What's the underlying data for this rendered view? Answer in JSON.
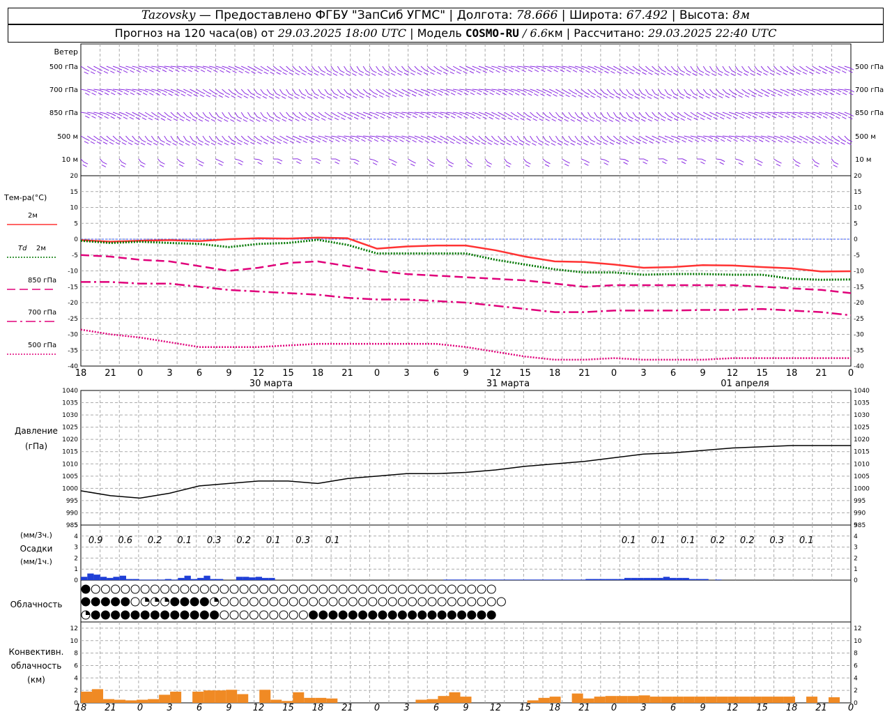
{
  "header": {
    "station": "Tazovsky",
    "dash": "—",
    "provider": "Предоставлено ФГБУ \"ЗапСиб УГМС\"",
    "sep": "|",
    "lon_label": "Долгота:",
    "lon_value": "78.666",
    "lat_label": "Широта:",
    "lat_value": "67.492",
    "alt_label": "Высота:",
    "alt_value": "8м"
  },
  "subheader": {
    "forecast_prefix": "Прогноз на 120 часа(ов) от",
    "forecast_time": "29.03.2025 18:00 UTC",
    "model_label": "Модель",
    "model_name": "COSMO-RU",
    "model_res": "/ 6.6",
    "model_res_unit": "км",
    "calc_label": "Рассчитано:",
    "calc_time": "29.03.2025 22:40 UTC"
  },
  "wind_panel": {
    "title": "Ветер",
    "levels": [
      "500 гПа",
      "700 гПа",
      "850 гПа",
      "500 м",
      "10  м"
    ],
    "levels_right": [
      "500 гПа",
      "700 гПа",
      "850 гПа",
      "500 м",
      "10 м"
    ],
    "barb_color": "#8a2be2"
  },
  "temp_panel": {
    "title": "Тем-ра(°С)",
    "ticks": [
      20,
      15,
      10,
      5,
      0,
      -5,
      -10,
      -15,
      -20,
      -25,
      -30,
      -35,
      -40
    ],
    "legend": [
      {
        "label": "2м",
        "color": "#ff3333",
        "style": "solid"
      },
      {
        "label_prefix": "Td",
        "label": "2м",
        "color": "#007700",
        "style": "dotted"
      },
      {
        "label": "850 гПа",
        "color": "#e0007a",
        "style": "dashed"
      },
      {
        "label": "700 гПа",
        "color": "#e0007a",
        "style": "dashdot"
      },
      {
        "label": "500 гПа",
        "color": "#e0007a",
        "style": "dotted"
      }
    ]
  },
  "time_axis": {
    "hour_labels": [
      "18",
      "21",
      "0",
      "3",
      "6",
      "9",
      "12",
      "15",
      "18",
      "21",
      "0",
      "3",
      "6",
      "9",
      "12",
      "15",
      "18",
      "21",
      "0",
      "3",
      "6",
      "9",
      "12",
      "15",
      "18",
      "21",
      "0"
    ],
    "day_labels": [
      "30 марта",
      "31 марта",
      "01 апреля"
    ]
  },
  "pressure_panel": {
    "title": "Давление",
    "unit": "(гПа)",
    "ticks": [
      1040,
      1035,
      1030,
      1025,
      1020,
      1015,
      1010,
      1005,
      1000,
      995,
      990,
      985
    ]
  },
  "precip_panel": {
    "title_top": "(мм/3ч.)",
    "title": "Осадки",
    "title_bottom": "(мм/1ч.)",
    "ticks": [
      5,
      4,
      3,
      2,
      1,
      0
    ],
    "amounts_3h": [
      "0.9",
      "0.6",
      "0.2",
      "0.1",
      "0.3",
      "0.2",
      "0.1",
      "0.3",
      "0.1",
      "",
      "",
      "",
      "",
      "",
      "",
      "",
      "",
      "",
      "0.1",
      "0.1",
      "0.1",
      "0.2",
      "0.2",
      "0.3",
      "0.1",
      "",
      ""
    ],
    "bar_color": "#1f3fd6"
  },
  "cloud_panel": {
    "title": "Облачность"
  },
  "conv_panel": {
    "title_lines": [
      "Конвективн.",
      "облачность",
      "(км)"
    ],
    "ticks": [
      12,
      10,
      8,
      6,
      4,
      2,
      0
    ],
    "bar_color": "#f08a24"
  },
  "chart_data": [
    {
      "type": "line",
      "title": "Тем-ра(°С)",
      "x": [
        "29.03 18",
        "21",
        "30.03 00",
        "03",
        "06",
        "09",
        "12",
        "15",
        "18",
        "21",
        "31.03 00",
        "03",
        "06",
        "09",
        "12",
        "15",
        "18",
        "21",
        "01.04 00",
        "03",
        "06",
        "09",
        "12",
        "15",
        "18",
        "21",
        "02.04 00"
      ],
      "ylim": [
        -40,
        20
      ],
      "series": [
        {
          "name": "2м",
          "values": [
            -0.3,
            -0.8,
            -0.5,
            -0.3,
            -0.6,
            0,
            0.3,
            0.2,
            0.5,
            0.3,
            -3,
            -2.3,
            -2,
            -2,
            -3.5,
            -5.5,
            -7,
            -7.2,
            -8,
            -9,
            -8.8,
            -8.2,
            -8.3,
            -8.8,
            -9.2,
            -10.2,
            -10.1
          ]
        },
        {
          "name": "Td 2м",
          "values": [
            -0.5,
            -1.2,
            -0.8,
            -1.2,
            -1.5,
            -2.5,
            -1.5,
            -1.2,
            -0.2,
            -1.8,
            -4.5,
            -4.5,
            -4.5,
            -4.5,
            -6.5,
            -8,
            -9.5,
            -10.5,
            -10.5,
            -11.2,
            -11,
            -11,
            -11.2,
            -11.2,
            -12.5,
            -12.8,
            -12.7
          ]
        },
        {
          "name": "850 гПа",
          "values": [
            -5,
            -5.5,
            -6.5,
            -7,
            -8.5,
            -10,
            -9,
            -7.5,
            -7,
            -8.5,
            -10,
            -11,
            -11.5,
            -12,
            -12.5,
            -13,
            -14,
            -15,
            -14.5,
            -14.5,
            -14.5,
            -14.5,
            -14.5,
            -15,
            -15.5,
            -16,
            -17
          ]
        },
        {
          "name": "700 гПа",
          "values": [
            -13.5,
            -13.5,
            -14,
            -14,
            -15,
            -16,
            -16.5,
            -17,
            -17.5,
            -18.5,
            -19,
            -19,
            -19.5,
            -20,
            -21,
            -22,
            -23,
            -23,
            -22.5,
            -22.5,
            -22.5,
            -22.3,
            -22.3,
            -22,
            -22.5,
            -23,
            -24
          ]
        },
        {
          "name": "500 гПа",
          "values": [
            -28.5,
            -30,
            -31,
            -32.5,
            -34,
            -34,
            -34,
            -33.5,
            -33,
            -33,
            -33,
            -33,
            -33,
            -34,
            -35.5,
            -37,
            -38,
            -38,
            -37.5,
            -38,
            -38,
            -38,
            -37.5,
            -37.5,
            -37.5,
            -37.5,
            -37.5
          ]
        }
      ]
    },
    {
      "type": "line",
      "title": "Давление",
      "ylabel": "(гПа)",
      "x": [
        "29.03 18",
        "21",
        "30.03 00",
        "03",
        "06",
        "09",
        "12",
        "15",
        "18",
        "21",
        "31.03 00",
        "03",
        "06",
        "09",
        "12",
        "15",
        "18",
        "21",
        "01.04 00",
        "03",
        "06",
        "09",
        "12",
        "15",
        "18",
        "21",
        "02.04 00"
      ],
      "ylim": [
        985,
        1040
      ],
      "series": [
        {
          "values": [
            999,
            997,
            996,
            998,
            1001,
            1002,
            1003,
            1003,
            1002,
            1004,
            1005,
            1006,
            1006,
            1006.5,
            1007.5,
            1009,
            1010,
            1011,
            1012.5,
            1014,
            1014.5,
            1015.5,
            1016.5,
            1017,
            1017.5,
            1017.5,
            1017.5
          ]
        }
      ]
    },
    {
      "type": "bar",
      "title": "Осадки",
      "ylabel": "(мм/1ч.)",
      "ylim": [
        0,
        5
      ],
      "values": [
        0.3,
        0.6,
        0.5,
        0.3,
        0.2,
        0.3,
        0.4,
        0.1,
        0.1,
        0.05,
        0.05,
        0.05,
        0.05,
        0.1,
        0.05,
        0.2,
        0.4,
        0.1,
        0.2,
        0.4,
        0.1,
        0.1,
        0,
        0,
        0.3,
        0.3,
        0.25,
        0.3,
        0.2,
        0.2,
        0,
        0,
        0,
        0,
        0,
        0,
        0,
        0,
        0,
        0,
        0,
        0,
        0,
        0,
        0,
        0,
        0,
        0,
        0,
        0,
        0,
        0,
        0,
        0,
        0,
        0,
        0.05,
        0.05,
        0.05,
        0.05,
        0.05,
        0.05,
        0.05,
        0.05,
        0.05,
        0.05,
        0.05,
        0.05,
        0.05,
        0.05,
        0.05,
        0.05,
        0.05,
        0.05,
        0.05,
        0.05,
        0.05,
        0.05,
        0.1,
        0.1,
        0.1,
        0.1,
        0.1,
        0.1,
        0.2,
        0.2,
        0.2,
        0.2,
        0.2,
        0.2,
        0.3,
        0.2,
        0.2,
        0.2,
        0.1,
        0.1,
        0.1,
        0,
        0.05,
        0,
        0,
        0,
        0,
        0,
        0,
        0,
        0,
        0,
        0,
        0,
        0,
        0,
        0,
        0,
        0,
        0,
        0,
        0,
        0
      ]
    },
    {
      "type": "bar",
      "title": "Конвективн. облачность",
      "ylabel": "(км)",
      "ylim": [
        0,
        13
      ],
      "values": [
        1.8,
        2.2,
        0.6,
        0.5,
        0.4,
        0.5,
        0.6,
        1.3,
        1.8,
        0,
        1.8,
        2.0,
        2.0,
        2.1,
        1.4,
        0,
        2.1,
        0.5,
        0.3,
        1.7,
        0.8,
        0.8,
        0.7,
        0,
        0,
        0,
        0,
        0,
        0,
        0,
        0.5,
        0.6,
        1.1,
        1.7,
        1.0,
        0,
        0,
        0,
        0,
        0,
        0.4,
        0.8,
        1.0,
        0,
        1.5,
        0.7,
        1.0,
        1.1,
        1.1,
        1.1,
        1.2,
        1.0,
        1.0,
        1.0,
        1.0,
        1.0,
        1.0,
        1.0,
        1.0,
        1.0,
        1.0,
        1.0,
        1.0,
        1.0,
        0,
        1.0,
        0,
        0.9,
        0
      ]
    }
  ],
  "cloud_rows": {
    "upper": [
      "F",
      "F",
      "F",
      "E",
      "E",
      "E",
      "E",
      "E",
      "E",
      "E",
      "E",
      "E",
      "E",
      "E",
      "E",
      "E",
      "E",
      "E",
      "E",
      "E",
      "E",
      "E",
      "E",
      "E",
      "E",
      "E",
      "E",
      "E",
      "E",
      "E",
      "E",
      "E",
      "E",
      "E",
      "E",
      "E",
      "E",
      "E",
      "E",
      "E",
      "E",
      "E",
      "E",
      "E",
      "E",
      "E",
      "E",
      "E",
      "E",
      "E",
      "E",
      "E",
      "E",
      "E",
      "E",
      "E",
      "E",
      "E",
      "E",
      "E",
      "E",
      "E",
      "E",
      "E",
      "E",
      "E",
      "E",
      "E",
      "E",
      "E",
      "E",
      "E",
      "E",
      "E",
      "E",
      "E",
      "E",
      "E",
      "E",
      "E",
      "E",
      "E",
      "E",
      "E",
      "E",
      "E",
      "E",
      "E",
      "E",
      "E",
      "E",
      "E",
      "E",
      "E",
      "E",
      "E",
      "E",
      "E",
      "E",
      "E",
      "E",
      "E",
      "E",
      "E",
      "E",
      "E",
      "E",
      "E",
      "E",
      "E",
      "E",
      "E",
      "E",
      "E",
      "E",
      "E",
      "E",
      "E",
      "E",
      "E",
      "E",
      "E",
      "E",
      "E",
      "E",
      "E"
    ],
    "middle": [
      "F",
      "F",
      "F",
      "F",
      "F",
      "F",
      "F",
      "F",
      "F",
      "F",
      "F",
      "F",
      "F",
      "Q",
      "E",
      "E",
      "E",
      "Q",
      "Q",
      "Q",
      "Q",
      "Q",
      "Q",
      "Q",
      "Q",
      "F",
      "F",
      "F",
      "F",
      "F",
      "F",
      "F",
      "F",
      "F",
      "F",
      "F",
      "F",
      "Q",
      "Q",
      "Q",
      "E",
      "E",
      "E",
      "E",
      "E",
      "E",
      "E",
      "E",
      "E",
      "E",
      "E",
      "E",
      "E",
      "E",
      "E",
      "E",
      "E",
      "E",
      "E",
      "E",
      "E",
      "E",
      "E",
      "E",
      "E",
      "E",
      "E",
      "E",
      "E",
      "E",
      "E",
      "E",
      "E",
      "E",
      "E",
      "E",
      "E",
      "E",
      "E",
      "E",
      "E",
      "E",
      "E",
      "E",
      "E",
      "E",
      "E",
      "E",
      "E",
      "E",
      "E",
      "E",
      "E",
      "E",
      "E",
      "E",
      "E",
      "E",
      "E",
      "E",
      "E",
      "E",
      "E",
      "E",
      "E",
      "E",
      "E",
      "E",
      "E",
      "E",
      "E",
      "E",
      "E",
      "E",
      "E",
      "E",
      "E",
      "E",
      "E",
      "E",
      "E",
      "E",
      "E",
      "E",
      "E",
      "E",
      "E"
    ],
    "lower": [
      "Q",
      "F",
      "F",
      "F",
      "F",
      "F",
      "F",
      "F",
      "F",
      "F",
      "F",
      "F",
      "F",
      "F",
      "F",
      "F",
      "F",
      "F",
      "F",
      "F",
      "F",
      "F",
      "F",
      "F",
      "F",
      "F",
      "F",
      "F",
      "F",
      "F",
      "F",
      "F",
      "F",
      "F",
      "F",
      "F",
      "F",
      "F",
      "F",
      "F",
      "E",
      "E",
      "E",
      "E",
      "E",
      "E",
      "E",
      "E",
      "E",
      "E",
      "E",
      "E",
      "E",
      "E",
      "E",
      "E",
      "E",
      "E",
      "E",
      "E",
      "E",
      "E",
      "E",
      "E",
      "E",
      "E",
      "E",
      "E",
      "E",
      "F",
      "F",
      "F",
      "F",
      "F",
      "F",
      "F",
      "F",
      "F",
      "F",
      "F",
      "F",
      "F",
      "F",
      "F",
      "F",
      "F",
      "F",
      "F",
      "F",
      "F",
      "F",
      "F",
      "F",
      "F",
      "F",
      "F",
      "F",
      "F",
      "F",
      "F",
      "F",
      "F",
      "F",
      "F",
      "F",
      "F",
      "F",
      "F",
      "F",
      "F",
      "F",
      "F",
      "F",
      "F",
      "F",
      "F",
      "F",
      "F",
      "F",
      "F",
      "F",
      "F",
      "F",
      "F",
      "F",
      "F"
    ]
  }
}
